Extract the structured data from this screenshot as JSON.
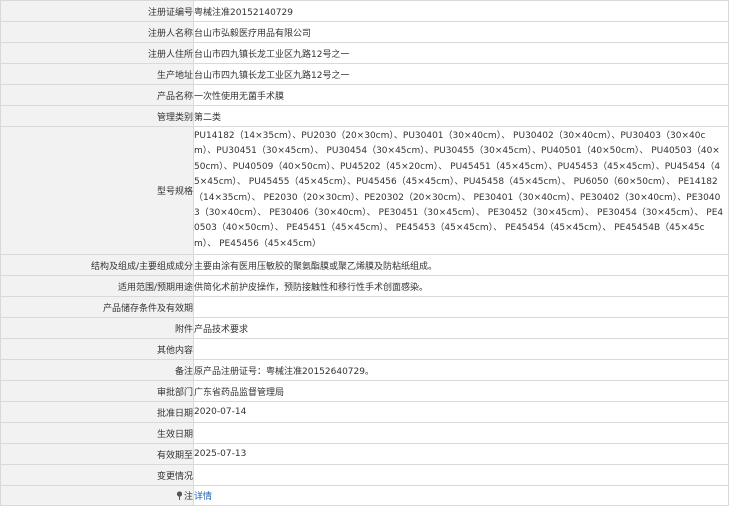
{
  "rows": [
    {
      "label": "注册证编号",
      "value": "粤械注准20152140729"
    },
    {
      "label": "注册人名称",
      "value": "台山市弘毅医疗用品有限公司"
    },
    {
      "label": "注册人住所",
      "value": "台山市四九镇长龙工业区九路12号之一"
    },
    {
      "label": "生产地址",
      "value": "台山市四九镇长龙工业区九路12号之一"
    },
    {
      "label": "产品名称",
      "value": "一次性使用无菌手术膜"
    },
    {
      "label": "管理类别",
      "value": "第二类"
    },
    {
      "label": "型号规格",
      "value": "PU14182（14×35cm）、PU2030（20×30cm）、PU30401（30×40cm）、 PU30402（30×40cm）、PU30403（30×40cm）、PU30451（30×45cm）、 PU30454（30×45cm）、PU30455（30×45cm）、PU40501（40×50cm）、 PU40503（40×50cm）、PU40509（40×50cm）、PU45202（45×20cm）、 PU45451（45×45cm）、PU45453（45×45cm）、PU45454（45×45cm）、 PU45455（45×45cm）、PU45456（45×45cm）、PU45458（45×45cm）、 PU6050（60×50cm）、 PE14182（14×35cm）、 PE2030（20×30cm）、PE20302（20×30cm）、 PE30401（30×40cm）、PE30402（30×40cm）、PE30403（30×40cm）、 PE30406（30×40cm）、 PE30451（30×45cm）、 PE30452（30×45cm）、 PE30454（30×45cm）、 PE40503（40×50cm）、 PE45451（45×45cm）、 PE45453（45×45cm）、 PE45454（45×45cm）、 PE45454B（45×45cm）、 PE45456（45×45cm）"
    },
    {
      "label": "结构及组成/主要组成成分",
      "value": "主要由涂有医用压敏胶的聚氨酯膜或聚乙烯膜及防粘纸组成。"
    },
    {
      "label": "适用范围/预期用途",
      "value": "供简化术前护皮操作，预防接触性和移行性手术创面感染。"
    },
    {
      "label": "产品储存条件及有效期",
      "value": ""
    },
    {
      "label": "附件",
      "value": "产品技术要求"
    },
    {
      "label": "其他内容",
      "value": ""
    },
    {
      "label": "备注",
      "value": "原产品注册证号：粤械注准20152640729。"
    },
    {
      "label": "审批部门",
      "value": "广东省药品监督管理局"
    },
    {
      "label": "批准日期",
      "value": "2020-07-14"
    },
    {
      "label": "生效日期",
      "value": ""
    },
    {
      "label": "有效期至",
      "value": "2025-07-13"
    },
    {
      "label": "变更情况",
      "value": ""
    }
  ],
  "note_row": {
    "label": "注",
    "link_text": "详情",
    "icon": "pin-icon"
  }
}
